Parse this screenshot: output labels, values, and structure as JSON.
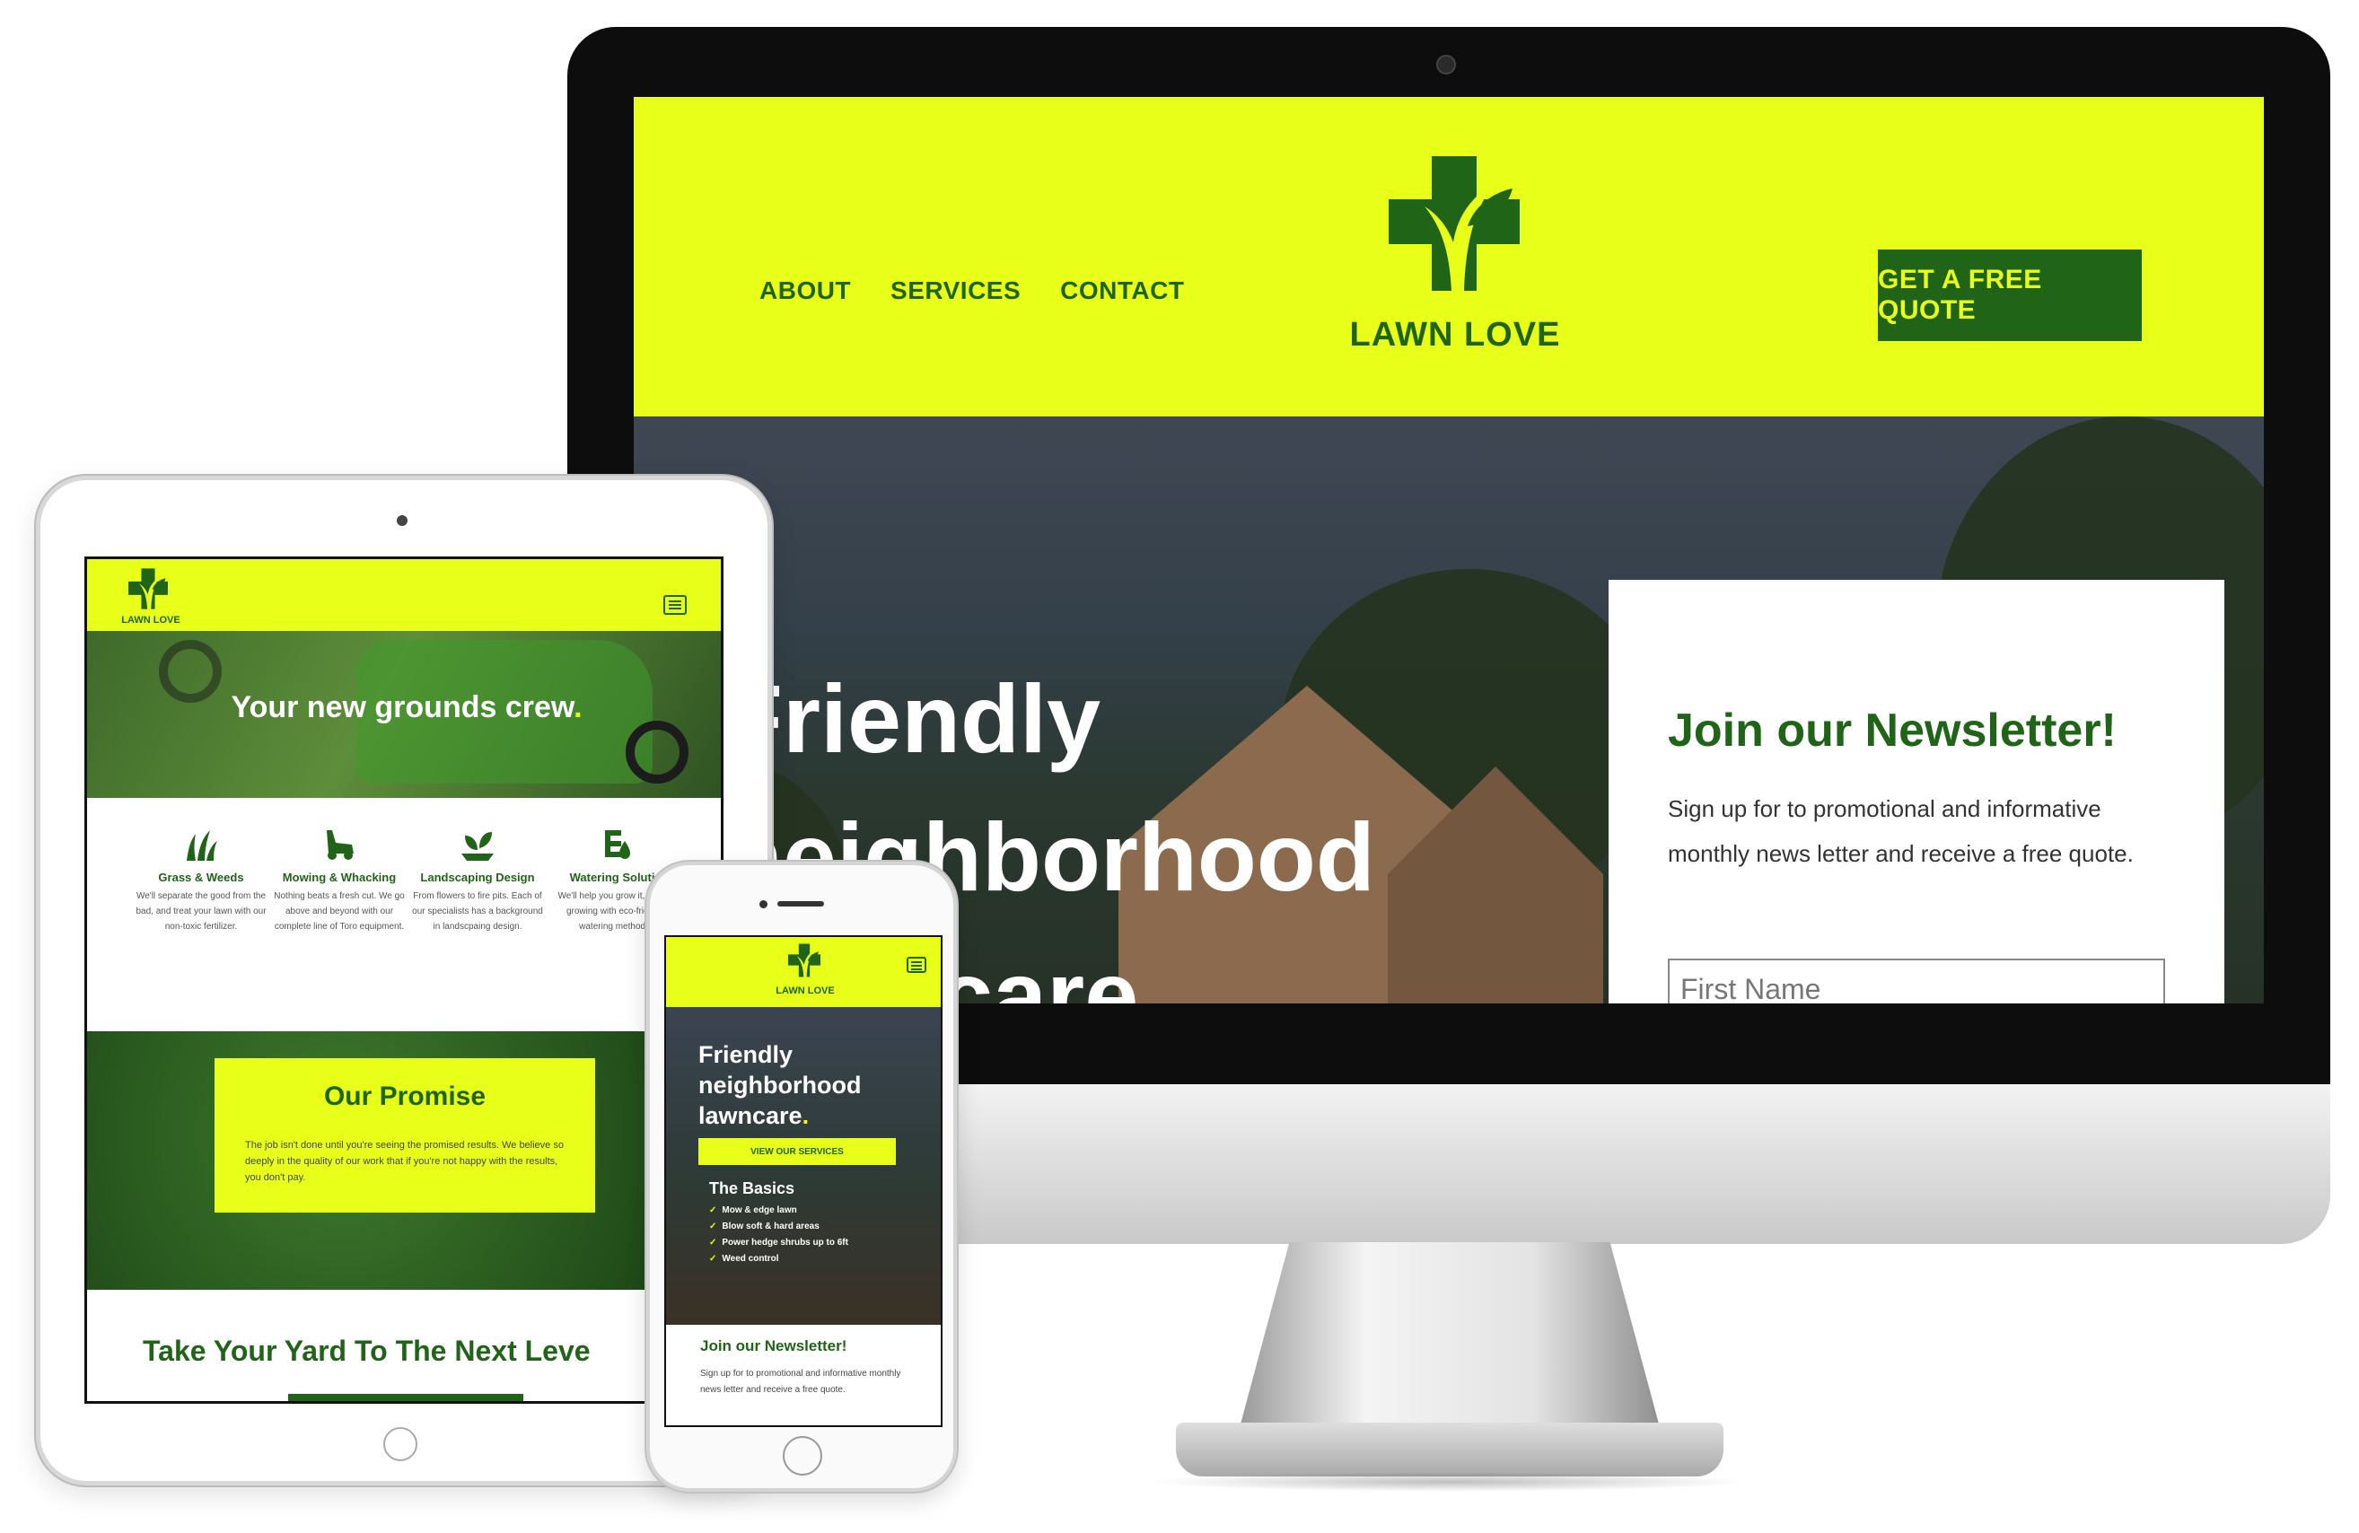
{
  "colors": {
    "brand_yellow": "#e8ff1a",
    "brand_green": "#206418"
  },
  "desktop": {
    "nav": [
      "ABOUT",
      "SERVICES",
      "CONTACT"
    ],
    "logo_text": "LAWN LOVE",
    "cta": "GET A FREE QUOTE",
    "hero_lines": [
      "Friendly",
      "neighborhood",
      "lawncare"
    ],
    "newsletter": {
      "title": "Join our Newsletter!",
      "body": "Sign up for to promotional and informative monthly news letter and receive a free quote.",
      "first_name_placeholder": "First Name"
    }
  },
  "tablet": {
    "logo_text": "LAWN LOVE",
    "hero_title": "Your new grounds crew",
    "services": [
      {
        "name": "Grass & Weeds",
        "icon": "grass-icon",
        "desc": "We'll separate the good from the bad, and treat your lawn with our non-toxic fertilizer."
      },
      {
        "name": "Mowing & Whacking",
        "icon": "mower-icon",
        "desc": "Nothing beats a fresh cut. We go above and beyond with our complete line of Toro equipment."
      },
      {
        "name": "Landscaping Design",
        "icon": "plant-icon",
        "desc": "From flowers to fire pits. Each of our specialists has a background in landscpaing design."
      },
      {
        "name": "Watering Solutio",
        "icon": "watering-icon",
        "desc": "We'll help you grow it, keep it growing with eco-friendly watering methods."
      }
    ],
    "promise": {
      "title": "Our Promise",
      "body": "The job isn't done until you're seeing the promised results. We believe so deeply in the quality of our work that if you're not happy with the results, you don't pay."
    },
    "bottom_title": "Take Your Yard To The Next Leve"
  },
  "phone": {
    "logo_text": "LAWN LOVE",
    "hero_lines": [
      "Friendly",
      "neighborhood",
      "lawncare"
    ],
    "button": "VIEW OUR SERVICES",
    "basics_title": "The Basics",
    "basics": [
      "Mow & edge lawn",
      "Blow soft & hard areas",
      "Power hedge shrubs up to 6ft",
      "Weed control"
    ],
    "newsletter": {
      "title": "Join our Newsletter!",
      "body": "Sign up for to promotional and informative monthly news letter and receive a free quote."
    }
  }
}
